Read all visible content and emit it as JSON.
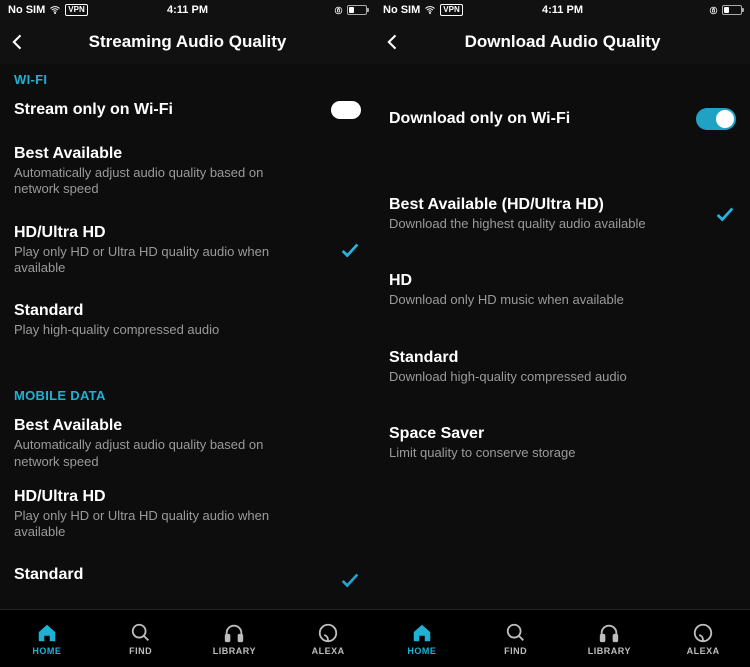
{
  "status": {
    "carrier": "No SIM",
    "vpn": "VPN",
    "time": "4:11 PM"
  },
  "left": {
    "title": "Streaming Audio Quality",
    "sections": {
      "wifi": {
        "header": "WI-FI",
        "toggle": {
          "label": "Stream only on Wi-Fi",
          "on": false
        },
        "opts": [
          {
            "title": "Best Available",
            "sub": "Automatically adjust audio quality based on network speed",
            "checked": false
          },
          {
            "title": "HD/Ultra HD",
            "sub": "Play only HD or Ultra HD quality audio when available",
            "checked": true
          },
          {
            "title": "Standard",
            "sub": "Play high-quality compressed audio",
            "checked": false
          }
        ]
      },
      "mobile": {
        "header": "MOBILE DATA",
        "opts": [
          {
            "title": "Best Available",
            "sub": "Automatically adjust audio quality based on network speed",
            "checked": false
          },
          {
            "title": "HD/Ultra HD",
            "sub": "Play only HD or Ultra HD quality audio when available",
            "checked": false
          },
          {
            "title": "Standard",
            "sub": "",
            "checked": true
          }
        ]
      }
    }
  },
  "right": {
    "title": "Download Audio Quality",
    "toggle": {
      "label": "Download only on Wi-Fi",
      "on": true
    },
    "opts": [
      {
        "title": "Best Available (HD/Ultra HD)",
        "sub": "Download the highest quality audio available",
        "checked": true
      },
      {
        "title": "HD",
        "sub": "Download only HD music when available",
        "checked": false
      },
      {
        "title": "Standard",
        "sub": "Download high-quality compressed audio",
        "checked": false
      },
      {
        "title": "Space Saver",
        "sub": "Limit quality to conserve storage",
        "checked": false
      }
    ]
  },
  "nav": {
    "home": "HOME",
    "find": "FIND",
    "library": "LIBRARY",
    "alexa": "ALEXA"
  }
}
